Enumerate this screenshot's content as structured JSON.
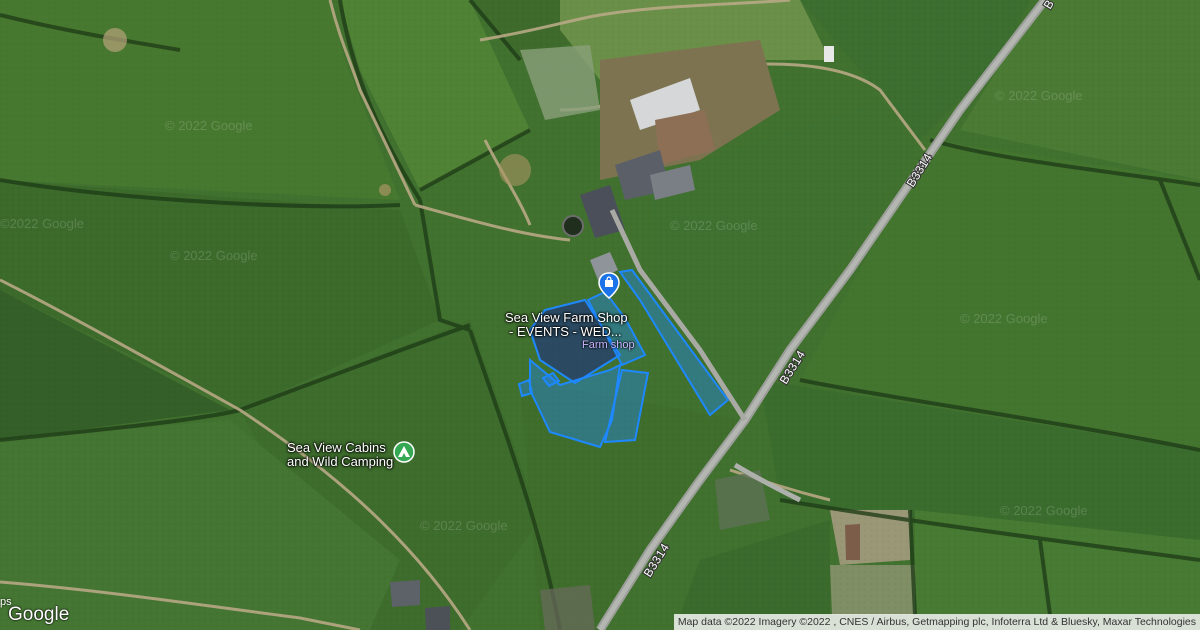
{
  "map": {
    "imagery_copyright": "© 2022 Google",
    "roads": [
      {
        "label": "B3314"
      },
      {
        "label": "B3314"
      },
      {
        "label": "B3314"
      },
      {
        "label": "B"
      }
    ],
    "pois": [
      {
        "name_line1": "Sea View Farm Shop",
        "name_line2": "- EVENTS - WED...",
        "category": "Farm shop",
        "icon": "shopping-bag-icon",
        "color": "#1a73e8"
      },
      {
        "name_line1": "Sea View Cabins",
        "name_line2": "and Wild Camping",
        "icon": "campground-icon",
        "color": "#34a853"
      }
    ],
    "highlight_color": "#1e88ff",
    "logo": "Google",
    "logo_stub": "ps",
    "attribution": "Map data ©2022 Imagery ©2022 , CNES / Airbus, Getmapping plc, Infoterra Ltd & Bluesky, Maxar Technologies"
  }
}
